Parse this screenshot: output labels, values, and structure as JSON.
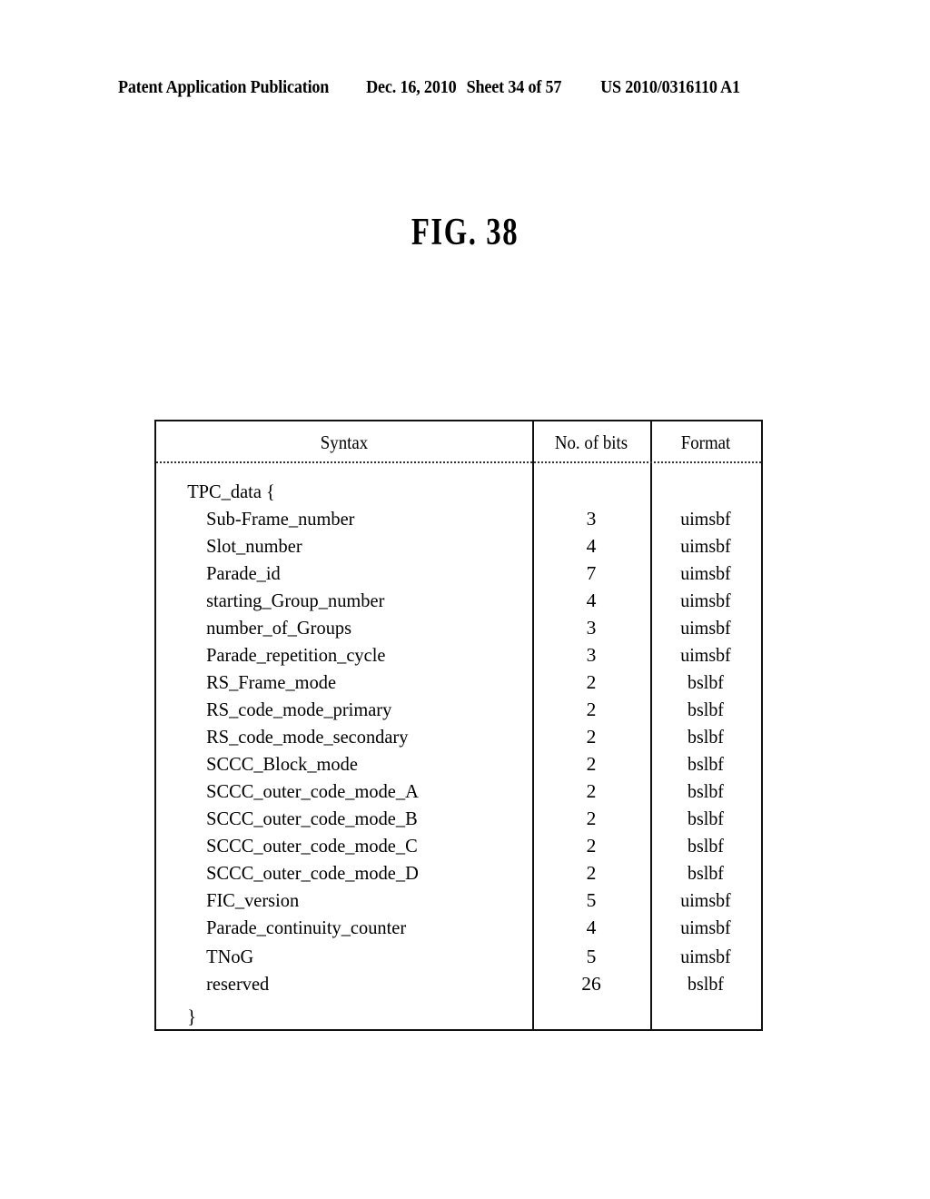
{
  "header": {
    "publication": "Patent Application Publication",
    "date": "Dec. 16, 2010",
    "sheet": "Sheet 34 of 57",
    "number": "US 2010/0316110 A1"
  },
  "figure": {
    "title": "FIG. 38"
  },
  "table": {
    "columns": [
      "Syntax",
      "No. of bits",
      "Format"
    ],
    "rows": [
      {
        "syntax": "TPC_data {",
        "bits": "",
        "format": "",
        "indent": 0
      },
      {
        "syntax": "Sub-Frame_number",
        "bits": "3",
        "format": "uimsbf",
        "indent": 1
      },
      {
        "syntax": "Slot_number",
        "bits": "4",
        "format": "uimsbf",
        "indent": 1
      },
      {
        "syntax": "Parade_id",
        "bits": "7",
        "format": "uimsbf",
        "indent": 1
      },
      {
        "syntax": "starting_Group_number",
        "bits": "4",
        "format": "uimsbf",
        "indent": 1
      },
      {
        "syntax": "number_of_Groups",
        "bits": "3",
        "format": "uimsbf",
        "indent": 1
      },
      {
        "syntax": "Parade_repetition_cycle",
        "bits": "3",
        "format": "uimsbf",
        "indent": 1
      },
      {
        "syntax": "RS_Frame_mode",
        "bits": "2",
        "format": "bslbf",
        "indent": 1
      },
      {
        "syntax": "RS_code_mode_primary",
        "bits": "2",
        "format": "bslbf",
        "indent": 1
      },
      {
        "syntax": "RS_code_mode_secondary",
        "bits": "2",
        "format": "bslbf",
        "indent": 1
      },
      {
        "syntax": "SCCC_Block_mode",
        "bits": "2",
        "format": "bslbf",
        "indent": 1
      },
      {
        "syntax": "SCCC_outer_code_mode_A",
        "bits": "2",
        "format": "bslbf",
        "indent": 1
      },
      {
        "syntax": "SCCC_outer_code_mode_B",
        "bits": "2",
        "format": "bslbf",
        "indent": 1
      },
      {
        "syntax": "SCCC_outer_code_mode_C",
        "bits": "2",
        "format": "bslbf",
        "indent": 1
      },
      {
        "syntax": "SCCC_outer_code_mode_D",
        "bits": "2",
        "format": "bslbf",
        "indent": 1
      },
      {
        "syntax": "FIC_version",
        "bits": "5",
        "format": "uimsbf",
        "indent": 1
      },
      {
        "syntax": "Parade_continuity_counter",
        "bits": "4",
        "format": "uimsbf",
        "indent": 1
      },
      {
        "syntax": "TNoG",
        "bits": "5",
        "format": "uimsbf",
        "indent": 1
      },
      {
        "syntax": "reserved",
        "bits": "26",
        "format": "bslbf",
        "indent": 1
      },
      {
        "syntax": "}",
        "bits": "",
        "format": "",
        "indent": 0
      }
    ]
  }
}
